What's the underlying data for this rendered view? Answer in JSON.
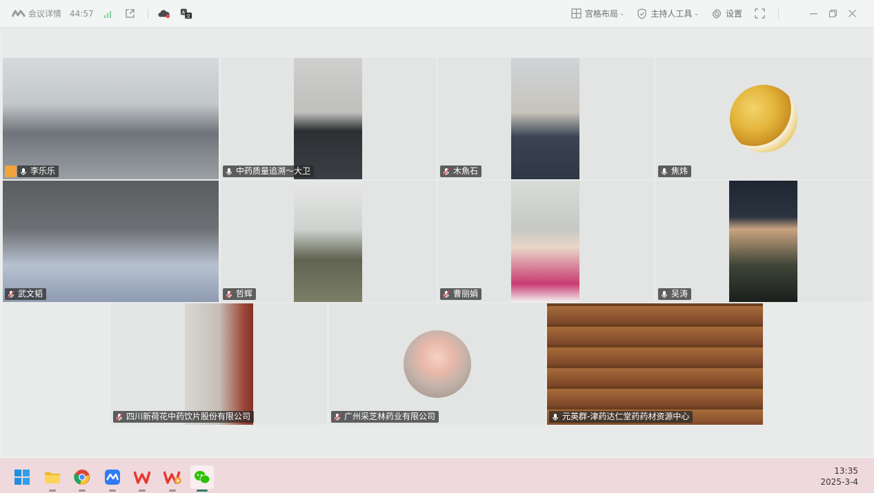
{
  "titlebar": {
    "meeting_label": "会议详情",
    "elapsed": "44:57",
    "layout_label": "宫格布局",
    "host_tools_label": "主持人工具",
    "settings_label": "设置"
  },
  "participants": [
    {
      "name": "李乐乐",
      "mic": "on",
      "active": true
    },
    {
      "name": "中药质量追溯～大卫",
      "mic": "on"
    },
    {
      "name": "木魚石",
      "mic": "muted"
    },
    {
      "name": "焦炜",
      "mic": "on"
    },
    {
      "name": "武文韬",
      "mic": "muted"
    },
    {
      "name": "哲辉",
      "mic": "muted"
    },
    {
      "name": "曹丽娟",
      "mic": "muted"
    },
    {
      "name": "吴涛",
      "mic": "on"
    },
    {
      "name": "四川新荷花中药饮片股份有限公司",
      "mic": "muted"
    },
    {
      "name": "广州采芝林药业有限公司",
      "mic": "muted"
    },
    {
      "name": "元英群-津药达仁堂药药材资源中心",
      "mic": "on"
    }
  ],
  "taskbar": {
    "apps": [
      "windows-start",
      "file-explorer",
      "chrome",
      "tencent-meeting",
      "wps-office",
      "wps-video",
      "wechat"
    ],
    "time": "13:35",
    "date": "2025-3-4"
  },
  "colors": {
    "active_border": "#3cc38a",
    "host_badge": "#f2a33a",
    "muted_mic": "#e5484d"
  }
}
